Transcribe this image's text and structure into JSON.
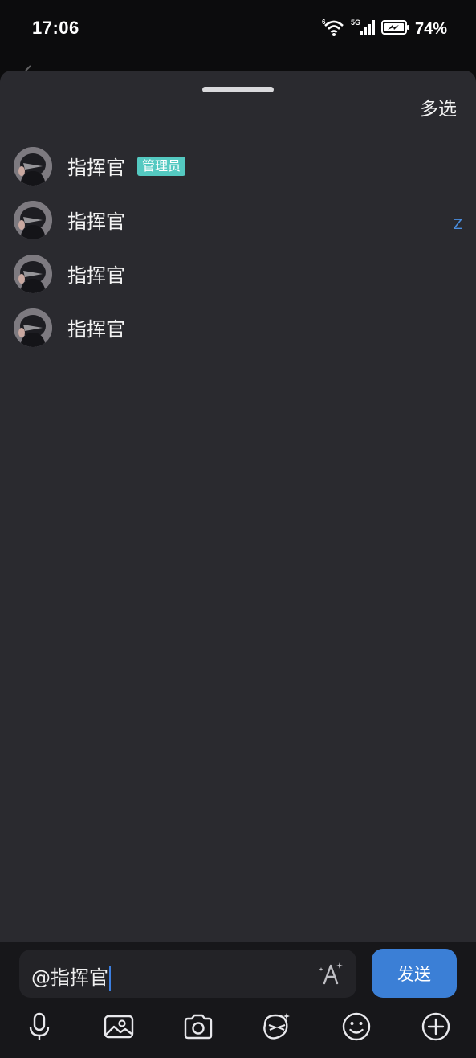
{
  "status_bar": {
    "time": "17:06",
    "battery": "74%",
    "icons": [
      "wifi-6-icon",
      "signal-5g-icon",
      "battery-charging-icon"
    ]
  },
  "sheet": {
    "multi_select_label": "多选",
    "members": [
      {
        "name": "指挥官",
        "badge": "管理员"
      },
      {
        "name": "指挥官"
      },
      {
        "name": "指挥官"
      },
      {
        "name": "指挥官"
      }
    ],
    "index_letter": "Z"
  },
  "composer": {
    "input_value": "@指挥官",
    "send_label": "发送",
    "tools": [
      "microphone-icon",
      "image-icon",
      "camera-icon",
      "sticker-icon",
      "emoji-icon",
      "plus-icon"
    ]
  },
  "colors": {
    "sheet_bg": "#2a2a2f",
    "badge": "#54c9c1",
    "send_button": "#3b7fd6",
    "index_letter": "#4a8ee0"
  }
}
